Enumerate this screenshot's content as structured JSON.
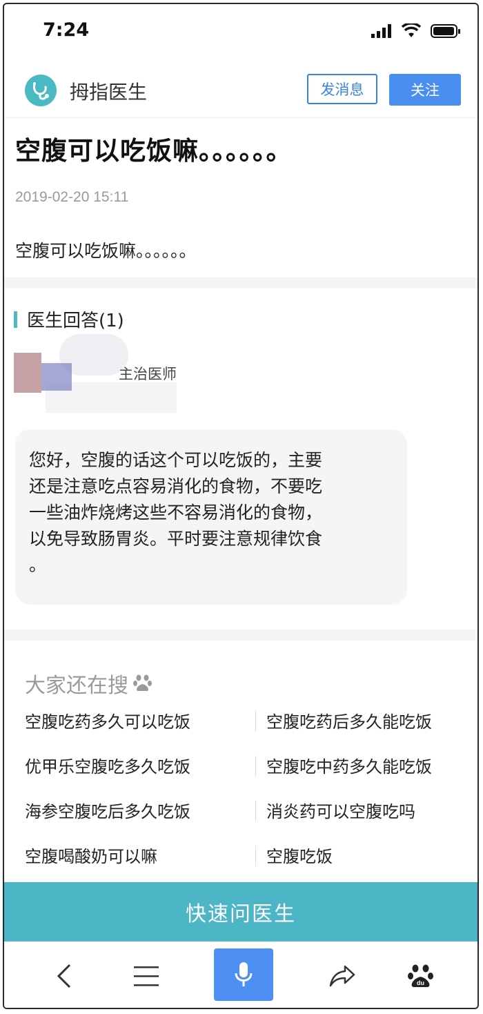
{
  "status_bar": {
    "time": "7:24"
  },
  "header": {
    "app_name": "拇指医生",
    "message_button": "发消息",
    "follow_button": "关注"
  },
  "question": {
    "title": "空腹可以吃饭嘛。。。。。。",
    "date": "2019-02-20 15:11",
    "body": "空腹可以吃饭嘛。。。。。。"
  },
  "answers": {
    "heading": "医生回答(1)",
    "doctor_title": "主治医师",
    "text_lines": [
      "您好，空腹的话这个可以吃饭的，主要",
      "还是注意吃点容易消化的食物，不要吃",
      "一些油炸烧烤这些不容易消化的食物，",
      "以免导致肠胃炎。平时要注意规律饮食",
      "。"
    ]
  },
  "related_search": {
    "heading": "大家还在搜",
    "items": [
      {
        "left": "空腹吃药多久可以吃饭",
        "right": "空腹吃药后多久能吃饭"
      },
      {
        "left": "优甲乐空腹吃多久吃饭",
        "right": "空腹吃中药多久能吃饭"
      },
      {
        "left": "海参空腹吃后多久吃饭",
        "right": "消炎药可以空腹吃吗"
      },
      {
        "left": "空腹喝酸奶可以嘛",
        "right": "空腹吃饭"
      }
    ]
  },
  "ask_button": "快速问医生",
  "colors": {
    "accent_teal": "#4db6c6",
    "primary_blue": "#4a8ff0"
  },
  "bottom_nav": {
    "icons": [
      "back-icon",
      "menu-icon",
      "microphone-icon",
      "share-icon",
      "baidu-paw-icon"
    ]
  }
}
